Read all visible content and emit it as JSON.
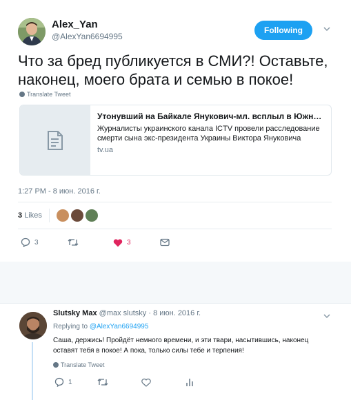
{
  "tweet": {
    "author_name": "Alex_Yan",
    "author_handle": "@AlexYan6694995",
    "follow_label": "Following",
    "text": "Что за бред публикуется в СМИ?! Оставьте, наконец, моего брата и семью в покое!",
    "translate_label": "Translate Tweet",
    "card": {
      "title": "Утонувший на Байкале Янукович-мл. всплыл в Южной А...",
      "description": "Журналисты украинского канала ICTV провели расследование смерти сына экс-президента Украины Виктора Януковича",
      "domain": "tv.ua",
      "icon": "document-icon"
    },
    "timestamp": "1:27 PM - 8 июн. 2016 г.",
    "likes_count": "3",
    "likes_label": "Likes",
    "actions": {
      "reply_count": "3",
      "retweet_count": "",
      "like_count": "3"
    }
  },
  "reply": {
    "author_name": "Slutsky Max",
    "author_handle": "@max slutsky",
    "date": "· 8 июн. 2016 г.",
    "replying_prefix": "Replying to",
    "replying_handle": "@AlexYan6694995",
    "text": "Саша, держись! Пройдёт немного времени, и эти твари, насытившись, наконец оставят тебя в покое! А пока, только силы тебе и терпения!",
    "translate_label": "Translate Tweet",
    "actions": {
      "reply_count": "1"
    }
  },
  "colors": {
    "accent": "#1da1f2",
    "like": "#e0245e",
    "muted": "#657786",
    "band": "#f5f8fa"
  }
}
